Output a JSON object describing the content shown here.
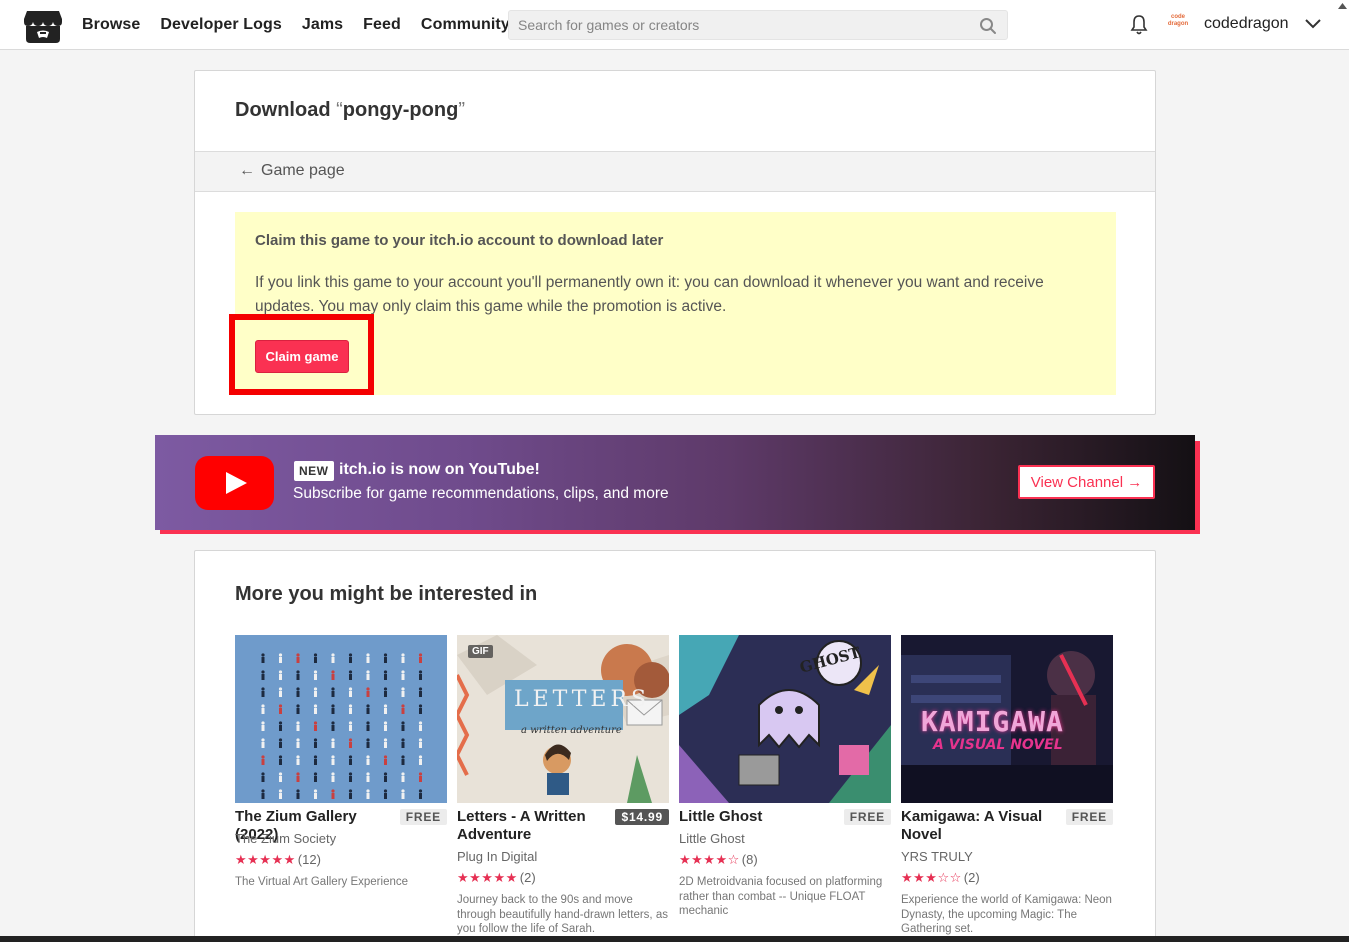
{
  "header": {
    "nav": [
      "Browse",
      "Developer Logs",
      "Jams",
      "Feed",
      "Community"
    ],
    "search_placeholder": "Search for games or creators",
    "avatar_text": "code dragon",
    "username": "codedragon"
  },
  "download": {
    "title_prefix": "Download",
    "open_quote": "“",
    "game_name": "pongy-pong",
    "close_quote": "”",
    "back_label": "Game page",
    "claim_heading": "Claim this game to your itch.io account to download later",
    "claim_text": "If you link this game to your account you'll permanently own it: you can download it whenever you want and receive updates. You may only claim this game while the promotion is active.",
    "claim_button": "Claim game"
  },
  "banner": {
    "new_label": "NEW",
    "title": "itch.io is now on YouTube!",
    "subtitle": "Subscribe for game recommendations, clips, and more",
    "button": "View Channel →"
  },
  "recommendations": {
    "title": "More you might be interested in",
    "games": [
      {
        "title": "The Zium Gallery (2022)",
        "price": "FREE",
        "author": "The Zium Society",
        "stars": "★★★★★",
        "count": "(12)",
        "description": "The Virtual Art Gallery Experience"
      },
      {
        "title": "Letters - A Written Adventure",
        "price": "$14.99",
        "author": "Plug In Digital",
        "stars": "★★★★★",
        "count": "(2)",
        "description": "Journey back to the 90s and move through beautifully hand-drawn letters, as you follow the life of Sarah.",
        "badge": "GIF",
        "art_title": "LETTERS",
        "art_subtitle": "a written adventure"
      },
      {
        "title": "Little Ghost",
        "price": "FREE",
        "author": "Little Ghost",
        "stars": "★★★★☆",
        "count": "(8)",
        "description": "2D Metroidvania focused on platforming rather than combat -- Unique FLOAT mechanic",
        "art_title": "GHOST"
      },
      {
        "title": "Kamigawa: A Visual Novel",
        "price": "FREE",
        "author": "YRS TRULY",
        "stars": "★★★☆☆",
        "count": "(2)",
        "description": "Experience the world of Kamigawa: Neon Dynasty, the upcoming Magic: The Gathering set.",
        "art_title": "KAMIGAWA",
        "art_subtitle": "A VISUAL NOVEL"
      }
    ]
  },
  "colors": {
    "accent": "#fa3152",
    "claim_bg": "#ffffc8",
    "highlight": "#f40000"
  }
}
